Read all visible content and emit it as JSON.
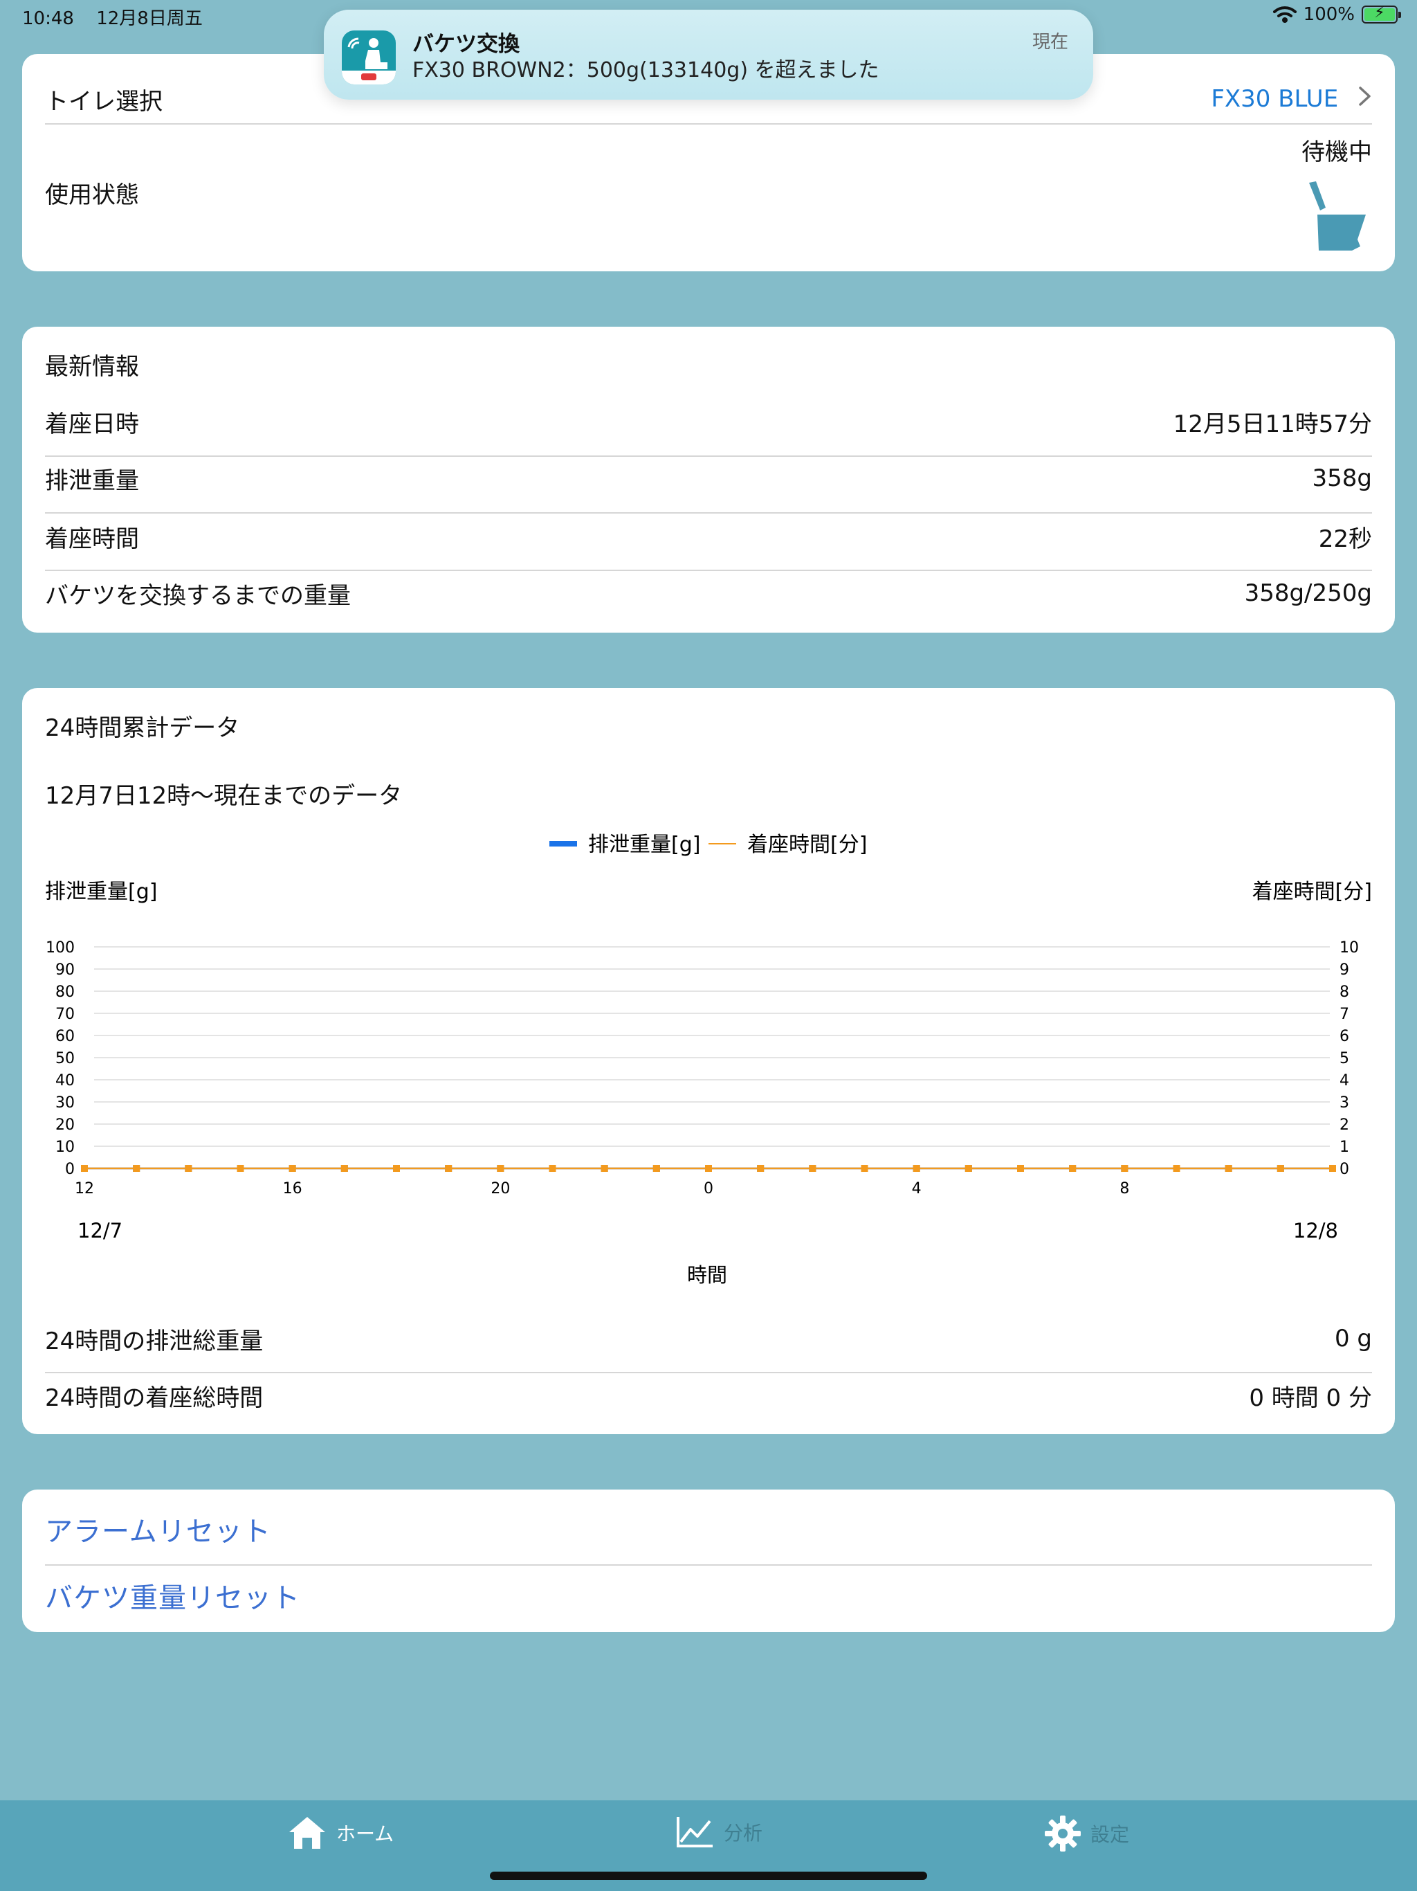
{
  "status_bar": {
    "time": "10:48",
    "date": "12月8日周五",
    "battery": "100%"
  },
  "notification": {
    "title": "バケツ交換",
    "body": "FX30 BROWN2：500g(133140g) を超えました",
    "time": "現在"
  },
  "toilet_card": {
    "select_label": "トイレ選択",
    "select_value": "FX30 BLUE",
    "status_label": "使用状態",
    "status_value": "待機中"
  },
  "latest_card": {
    "title": "最新情報",
    "rows": [
      {
        "label": "着座日時",
        "value": "12月5日11時57分"
      },
      {
        "label": "排泄重量",
        "value": "358g"
      },
      {
        "label": "着座時間",
        "value": "22秒"
      },
      {
        "label": "バケツを交換するまでの重量",
        "value": "358g/250g"
      }
    ]
  },
  "cumulative_card": {
    "title": "24時間累計データ",
    "subtitle": "12月7日12時〜現在までのデータ",
    "total_weight_label": "24時間の排泄総重量",
    "total_weight_value": "0 g",
    "total_time_label": "24時間の着座総時間",
    "total_time_value": "0 時間 0 分"
  },
  "chart_data": {
    "type": "line",
    "legend": [
      "排泄重量[g]",
      "着座時間[分]"
    ],
    "ylabel_left": "排泄重量[g]",
    "ylabel_right": "着座時間[分]",
    "xlabel": "時間",
    "ylim_left": [
      0,
      100
    ],
    "ylim_right": [
      0,
      10
    ],
    "yticks_left": [
      "100",
      "90",
      "80",
      "70",
      "60",
      "50",
      "40",
      "30",
      "20",
      "10",
      "0"
    ],
    "yticks_right": [
      "10",
      "9",
      "8",
      "7",
      "6",
      "5",
      "4",
      "3",
      "2",
      "1",
      "0"
    ],
    "x": [
      12,
      13,
      14,
      15,
      16,
      17,
      18,
      19,
      20,
      21,
      22,
      23,
      0,
      1,
      2,
      3,
      4,
      5,
      6,
      7,
      8,
      9,
      10,
      11
    ],
    "xticks": [
      "12",
      "16",
      "20",
      "0",
      "4",
      "8"
    ],
    "date_labels": [
      "12/7",
      "12/8"
    ],
    "series": [
      {
        "name": "排泄重量[g]",
        "color": "#1a73e8",
        "values": [
          0,
          0,
          0,
          0,
          0,
          0,
          0,
          0,
          0,
          0,
          0,
          0,
          0,
          0,
          0,
          0,
          0,
          0,
          0,
          0,
          0,
          0,
          0,
          0
        ]
      },
      {
        "name": "着座時間[分]",
        "color": "#f39a1e",
        "values": [
          0,
          0,
          0,
          0,
          0,
          0,
          0,
          0,
          0,
          0,
          0,
          0,
          0,
          0,
          0,
          0,
          0,
          0,
          0,
          0,
          0,
          0,
          0,
          0
        ]
      }
    ],
    "grid": true,
    "legend_position": "top-center"
  },
  "actions": {
    "alarm_reset": "アラームリセット",
    "bucket_reset": "バケツ重量リセット"
  },
  "tabbar": {
    "home": "ホーム",
    "analysis": "分析",
    "settings": "設定"
  },
  "colors": {
    "background": "#84bcc9",
    "card": "#ffffff",
    "link": "#1c7bd6",
    "action": "#3b6fd1",
    "tabbar": "#58a5ba",
    "toilet_icon": "#4a9ab4"
  }
}
